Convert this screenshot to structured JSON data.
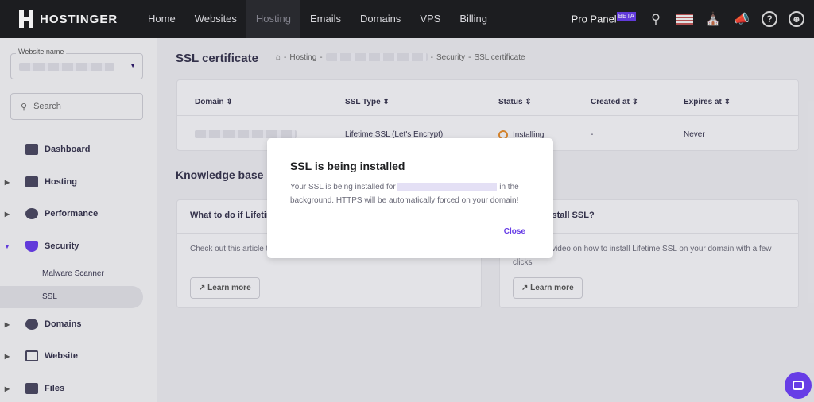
{
  "nav": {
    "brand": "HOSTINGER",
    "items": [
      "Home",
      "Websites",
      "Hosting",
      "Emails",
      "Domains",
      "VPS",
      "Billing"
    ],
    "pro_panel": "Pro Panel",
    "beta": "BETA"
  },
  "sidebar": {
    "website_label": "Website name",
    "search_placeholder": "Search",
    "items": [
      "Dashboard",
      "Hosting",
      "Performance",
      "Security",
      "Domains",
      "Website",
      "Files"
    ],
    "sub_items": [
      "Malware Scanner",
      "SSL"
    ]
  },
  "page": {
    "title": "SSL certificate",
    "breadcrumb": [
      "Hosting",
      "Security",
      "SSL certificate"
    ]
  },
  "table": {
    "headers": [
      "Domain",
      "SSL Type",
      "Status",
      "Created at",
      "Expires at"
    ],
    "row": {
      "ssl_type": "Lifetime SSL (Let's Encrypt)",
      "status": "Installing",
      "created": "-",
      "expires": "Never"
    }
  },
  "kb": {
    "title": "Knowledge base",
    "cards": [
      {
        "title": "What to do if Lifetime SSL is Failed?",
        "desc": "Check out this article to find out what to do when status is Failed",
        "button": "Learn more"
      },
      {
        "title": "How to install SSL?",
        "desc": "Watch this video on how to install Lifetime SSL on your domain with a few clicks",
        "button": "Learn more"
      }
    ]
  },
  "modal": {
    "title": "SSL is being installed",
    "text_before": "Your SSL is being installed for",
    "text_after": "in the background. HTTPS will be automatically forced on your domain!",
    "close": "Close"
  }
}
